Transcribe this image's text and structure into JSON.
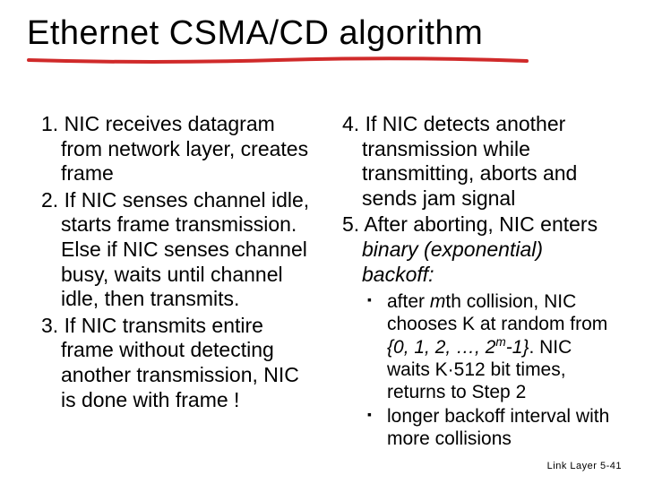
{
  "title": "Ethernet CSMA/CD algorithm",
  "left": {
    "i1": {
      "num": "1.",
      "text": "NIC receives datagram from network layer, creates frame"
    },
    "i2": {
      "num": "2.",
      "text": "If NIC senses channel idle, starts frame transmission. Else if NIC senses channel busy, waits until channel idle, then transmits."
    },
    "i3": {
      "num": "3.",
      "text": "If NIC transmits entire frame without detecting another transmission, NIC is done with frame !"
    }
  },
  "right": {
    "i4": {
      "num": "4.",
      "text": "If NIC detects another transmission while transmitting,  aborts and sends jam signal"
    },
    "i5": {
      "num": "5.",
      "pre": "After aborting, NIC enters ",
      "em": "binary (exponential) backoff:"
    },
    "b1": {
      "p1": "after ",
      "m": "m",
      "p2": "th collision, NIC chooses K at random from ",
      "set_open": "{0, 1, 2, …, 2",
      "set_close": "-1}",
      "p3": ". NIC waits K·512 bit times, returns to Step 2"
    },
    "b2": {
      "text": "longer backoff interval with more collisions"
    }
  },
  "footer": "Link Layer  5-41",
  "chart_data": {
    "type": "table",
    "note": "slide content; no quantitative chart"
  }
}
